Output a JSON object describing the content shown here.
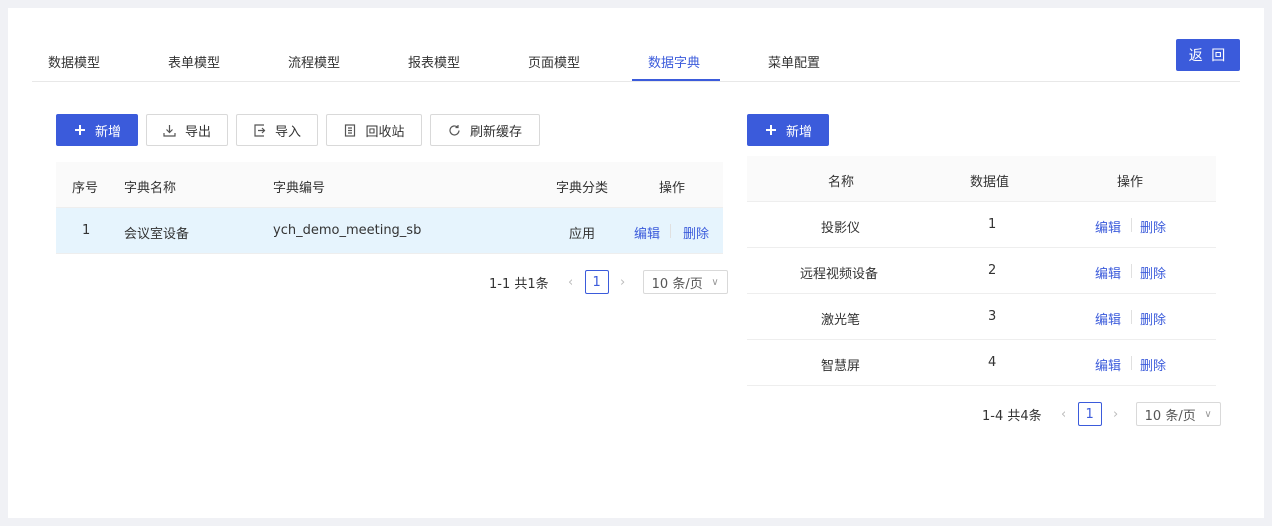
{
  "tabs": [
    {
      "label": "数据模型"
    },
    {
      "label": "表单模型"
    },
    {
      "label": "流程模型"
    },
    {
      "label": "报表模型"
    },
    {
      "label": "页面模型"
    },
    {
      "label": "数据字典",
      "active": true
    },
    {
      "label": "菜单配置"
    }
  ],
  "back_label": "返 回",
  "left": {
    "toolbar": {
      "add": "新增",
      "export": "导出",
      "import": "导入",
      "recycle": "回收站",
      "refresh": "刷新缓存"
    },
    "columns": [
      "序号",
      "字典名称",
      "字典编号",
      "字典分类",
      "操作"
    ],
    "rows": [
      {
        "index": "1",
        "name": "会议室设备",
        "code": "ych_demo_meeting_sb",
        "category": "应用",
        "edit": "编辑",
        "delete": "删除"
      }
    ],
    "pager": {
      "total": "1-1 共1条",
      "page": "1",
      "size": "10 条/页"
    }
  },
  "right": {
    "add": "新增",
    "columns": [
      "名称",
      "数据值",
      "操作"
    ],
    "rows": [
      {
        "name": "投影仪",
        "value": "1",
        "edit": "编辑",
        "delete": "删除"
      },
      {
        "name": "远程视频设备",
        "value": "2",
        "edit": "编辑",
        "delete": "删除"
      },
      {
        "name": "激光笔",
        "value": "3",
        "edit": "编辑",
        "delete": "删除"
      },
      {
        "name": "智慧屏",
        "value": "4",
        "edit": "编辑",
        "delete": "删除"
      }
    ],
    "pager": {
      "total": "1-4 共4条",
      "page": "1",
      "size": "10 条/页"
    }
  },
  "colors": {
    "accent": "#3b5bdb",
    "selected_row": "#e6f4fd",
    "header_bg": "#fafafa"
  }
}
